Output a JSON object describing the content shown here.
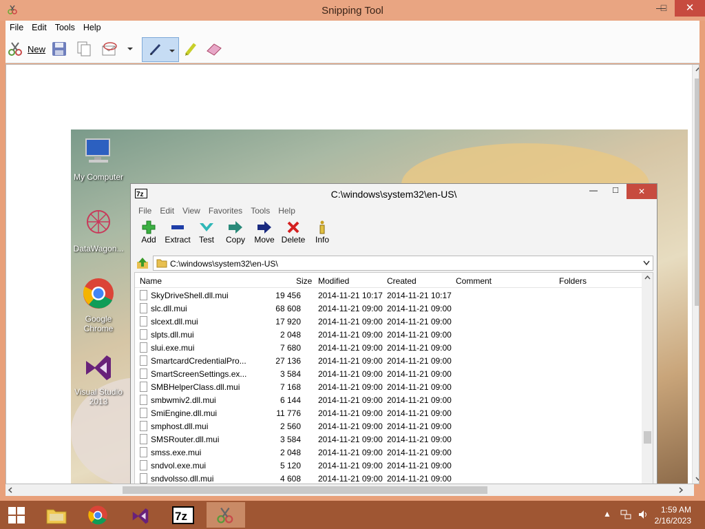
{
  "snip": {
    "title": "Snipping Tool",
    "menu": [
      "File",
      "Edit",
      "Tools",
      "Help"
    ],
    "new_label": "New"
  },
  "desktop": {
    "icons": [
      {
        "label": "My Computer"
      },
      {
        "label": "DataWagon..."
      },
      {
        "label": "Google Chrome"
      },
      {
        "label": "Visual Studio 2013"
      }
    ]
  },
  "zip": {
    "title": "C:\\windows\\system32\\en-US\\",
    "menu": [
      "File",
      "Edit",
      "View",
      "Favorites",
      "Tools",
      "Help"
    ],
    "tools": [
      "Add",
      "Extract",
      "Test",
      "Copy",
      "Move",
      "Delete",
      "Info"
    ],
    "address": "C:\\windows\\system32\\en-US\\",
    "columns": [
      "Name",
      "Size",
      "Modified",
      "Created",
      "Comment",
      "Folders"
    ],
    "rows": [
      {
        "name": "SkyDriveShell.dll.mui",
        "size": "19 456",
        "modified": "2014-11-21 10:17",
        "created": "2014-11-21 10:17"
      },
      {
        "name": "slc.dll.mui",
        "size": "68 608",
        "modified": "2014-11-21 09:00",
        "created": "2014-11-21 09:00"
      },
      {
        "name": "slcext.dll.mui",
        "size": "17 920",
        "modified": "2014-11-21 09:00",
        "created": "2014-11-21 09:00"
      },
      {
        "name": "slpts.dll.mui",
        "size": "2 048",
        "modified": "2014-11-21 09:00",
        "created": "2014-11-21 09:00"
      },
      {
        "name": "slui.exe.mui",
        "size": "7 680",
        "modified": "2014-11-21 09:00",
        "created": "2014-11-21 09:00"
      },
      {
        "name": "SmartcardCredentialPro...",
        "size": "27 136",
        "modified": "2014-11-21 09:00",
        "created": "2014-11-21 09:00"
      },
      {
        "name": "SmartScreenSettings.ex...",
        "size": "3 584",
        "modified": "2014-11-21 09:00",
        "created": "2014-11-21 09:00"
      },
      {
        "name": "SMBHelperClass.dll.mui",
        "size": "7 168",
        "modified": "2014-11-21 09:00",
        "created": "2014-11-21 09:00"
      },
      {
        "name": "smbwmiv2.dll.mui",
        "size": "6 144",
        "modified": "2014-11-21 09:00",
        "created": "2014-11-21 09:00"
      },
      {
        "name": "SmiEngine.dll.mui",
        "size": "11 776",
        "modified": "2014-11-21 09:00",
        "created": "2014-11-21 09:00"
      },
      {
        "name": "smphost.dll.mui",
        "size": "2 560",
        "modified": "2014-11-21 09:00",
        "created": "2014-11-21 09:00"
      },
      {
        "name": "SMSRouter.dll.mui",
        "size": "3 584",
        "modified": "2014-11-21 09:00",
        "created": "2014-11-21 09:00"
      },
      {
        "name": "smss.exe.mui",
        "size": "2 048",
        "modified": "2014-11-21 09:00",
        "created": "2014-11-21 09:00"
      },
      {
        "name": "sndvol.exe.mui",
        "size": "5 120",
        "modified": "2014-11-21 09:00",
        "created": "2014-11-21 09:00"
      },
      {
        "name": "sndvolsso.dll.mui",
        "size": "4 608",
        "modified": "2014-11-21 09:00",
        "created": "2014-11-21 09:00"
      }
    ]
  },
  "taskbar": {
    "time": "1:59 AM",
    "date": "2/16/2023"
  }
}
